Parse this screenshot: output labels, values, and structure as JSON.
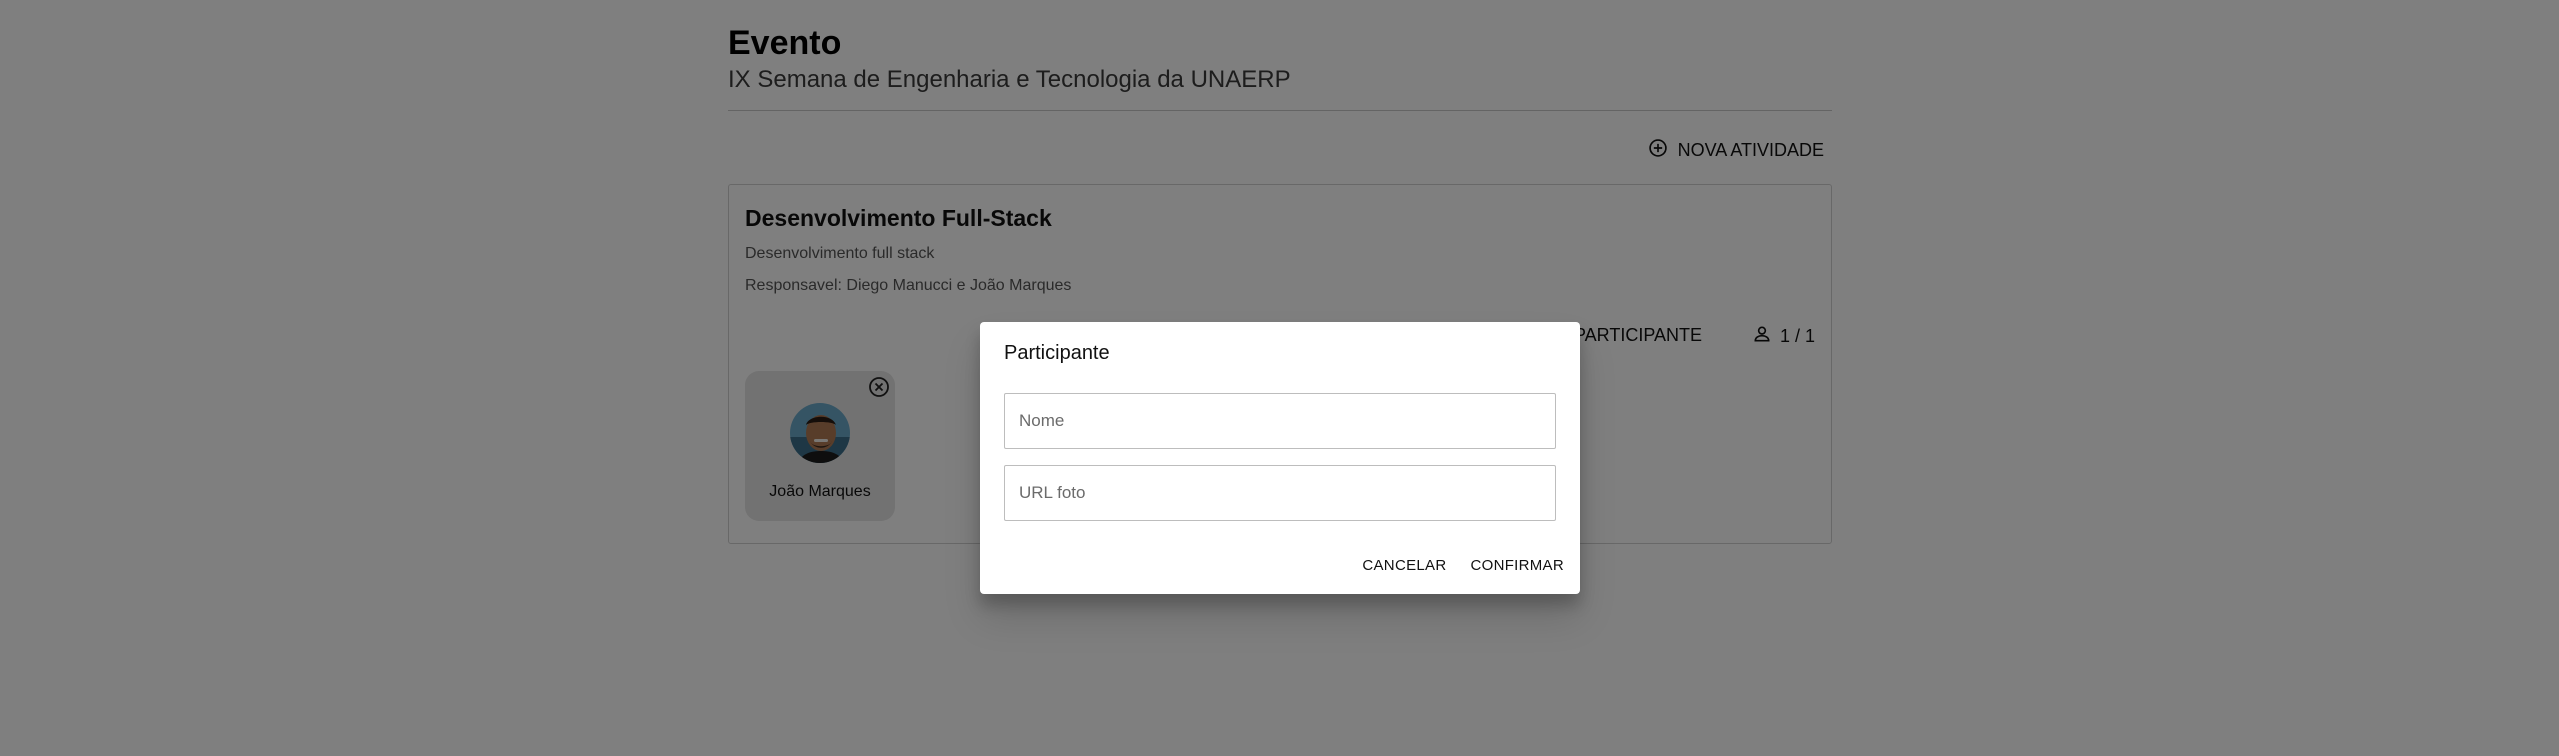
{
  "page": {
    "title": "Evento",
    "subtitle": "IX Semana de Engenharia e Tecnologia da UNAERP",
    "new_activity_label": "NOVA ATIVIDADE"
  },
  "activity": {
    "title": "Desenvolvimento Full-Stack",
    "description": "Desenvolvimento full stack",
    "responsible": "Responsavel: Diego Manucci e João Marques",
    "add_participant_label": "OVO PARTICIPANTE",
    "participant_count": "1 / 1",
    "participants": [
      {
        "name": "João Marques"
      }
    ]
  },
  "dialog": {
    "title": "Participante",
    "name_placeholder": "Nome",
    "url_placeholder": "URL foto",
    "cancel_label": "CANCELAR",
    "confirm_label": "CONFIRMAR"
  },
  "colors": {
    "overlay": "#000000",
    "text": "#1a1a1a",
    "card_border": "#d0d0d0",
    "participant_bg": "#e4e4e4"
  },
  "icons": {
    "new_activity": "plus-circle-icon",
    "count": "person-icon",
    "remove": "close-circle-icon"
  }
}
